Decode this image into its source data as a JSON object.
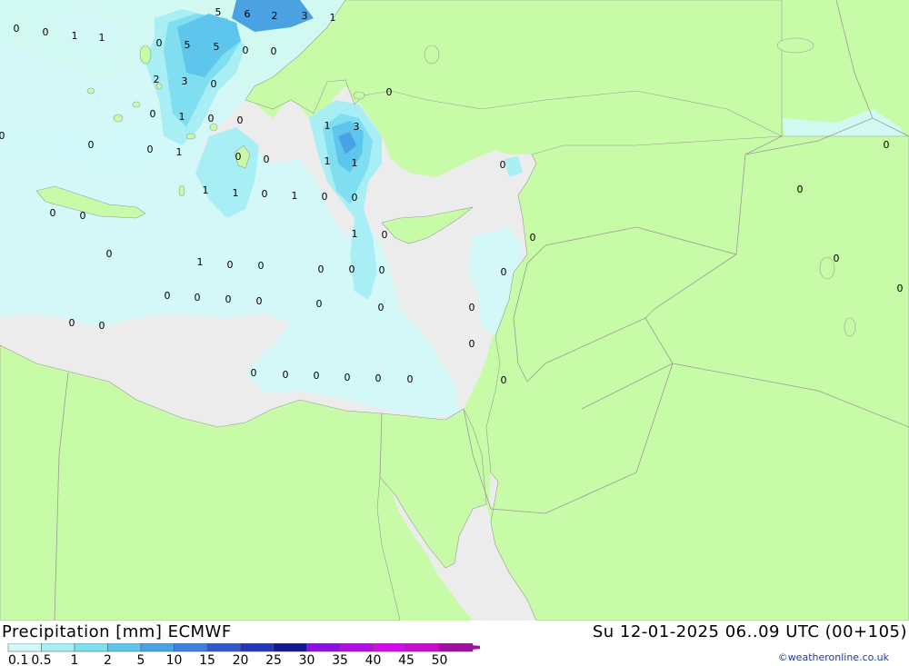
{
  "map": {
    "colors": {
      "land": "#c8fba8",
      "sea": "#ececec",
      "border": "#9a9a9a",
      "precip_0_1": "#d2f8fa",
      "precip_0_5": "#a8eef5",
      "precip_1": "#7fdff0",
      "precip_2": "#5ec6ec",
      "precip_5": "#4aa2e2"
    },
    "values": [
      "0",
      "0",
      "1",
      "1",
      "5",
      "6",
      "2",
      "3",
      "1",
      "0",
      "5",
      "5",
      "0",
      "0",
      "2",
      "3",
      "0",
      "0",
      "1",
      "0",
      "0",
      "0",
      "0",
      "0",
      "1",
      "0",
      "0",
      "1",
      "3",
      "1",
      "1",
      "1",
      "1",
      "0",
      "1",
      "0",
      "0",
      "0",
      "0",
      "0",
      "0",
      "0",
      "0",
      "0",
      "1",
      "0",
      "0",
      "0",
      "0",
      "0",
      "1",
      "0",
      "0",
      "0",
      "0",
      "0",
      "0",
      "0",
      "0",
      "0",
      "0",
      "0",
      "0",
      "0",
      "0",
      "0",
      "0",
      "0",
      "0",
      "0",
      "0",
      "0",
      "0",
      "0",
      "0"
    ]
  },
  "header": {
    "title": "Precipitation [mm] ECMWF",
    "datetime": "Su 12-01-2025 06..09 UTC (00+105)",
    "credit": "©weatheronline.co.uk"
  },
  "legend": {
    "labels": [
      "0.1",
      "0.5",
      "1",
      "2",
      "5",
      "10",
      "15",
      "20",
      "25",
      "30",
      "35",
      "40",
      "45",
      "50"
    ],
    "colors": [
      "#d2f8fa",
      "#a8eef5",
      "#7fdff0",
      "#5ec6ec",
      "#4aa2e2",
      "#3d7ede",
      "#3358cc",
      "#2436b8",
      "#14168f",
      "#8c10e6",
      "#b20ee6",
      "#d40cea",
      "#c80cc8",
      "#a0109e"
    ]
  }
}
